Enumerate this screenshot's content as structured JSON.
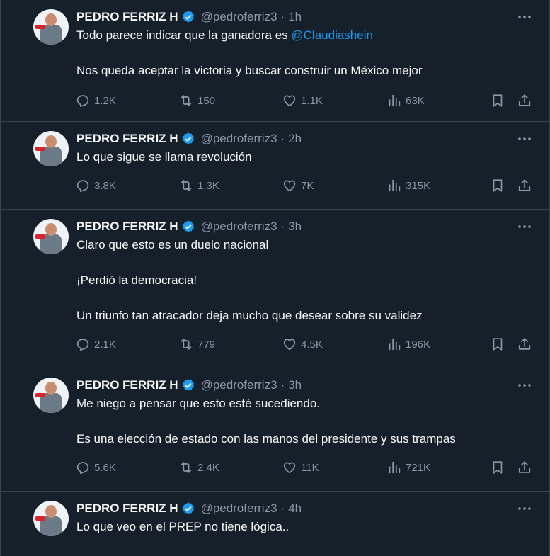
{
  "tweets": [
    {
      "name": "PEDRO FERRIZ H",
      "handle": "@pedroferriz3",
      "time": "1h",
      "paragraphs": [
        {
          "text": "Todo parece indicar que la ganadora es ",
          "mention": "@Claudiashein"
        },
        {
          "text": "Nos queda aceptar la victoria y buscar construir un México mejor"
        }
      ],
      "replies": "1.2K",
      "reposts": "150",
      "likes": "1.1K",
      "views": "63K"
    },
    {
      "name": "PEDRO FERRIZ H",
      "handle": "@pedroferriz3",
      "time": "2h",
      "paragraphs": [
        {
          "text": "Lo que sigue se llama revolución"
        }
      ],
      "replies": "3.8K",
      "reposts": "1.3K",
      "likes": "7K",
      "views": "315K"
    },
    {
      "name": "PEDRO FERRIZ H",
      "handle": "@pedroferriz3",
      "time": "3h",
      "paragraphs": [
        {
          "text": "Claro que esto es un duelo nacional"
        },
        {
          "text": "¡Perdió la democracia!"
        },
        {
          "text": "Un triunfo tan atracador deja mucho que desear sobre su validez"
        }
      ],
      "replies": "2.1K",
      "reposts": "779",
      "likes": "4.5K",
      "views": "196K"
    },
    {
      "name": "PEDRO FERRIZ H",
      "handle": "@pedroferriz3",
      "time": "3h",
      "paragraphs": [
        {
          "text": "Me niego a pensar que esto esté sucediendo."
        },
        {
          "text": "Es una elección de estado con las manos del presidente y sus trampas"
        }
      ],
      "replies": "5.6K",
      "reposts": "2.4K",
      "likes": "11K",
      "views": "721K"
    },
    {
      "name": "PEDRO FERRIZ H",
      "handle": "@pedroferriz3",
      "time": "4h",
      "paragraphs": [
        {
          "text": "Lo que veo en el PREP no tiene lógica.."
        }
      ]
    }
  ],
  "separator": "·",
  "icons": {
    "verified": "verified-badge-icon",
    "more": "more-dots-icon",
    "reply": "reply-bubble-icon",
    "repost": "repost-arrows-icon",
    "like": "heart-icon",
    "views": "views-bars-icon",
    "bookmark": "bookmark-icon",
    "share": "share-upload-icon"
  },
  "colors": {
    "background": "#15202b",
    "border": "#38444d",
    "text": "#f7f9f9",
    "muted": "#8b98a5",
    "accent": "#1d9bf0"
  }
}
